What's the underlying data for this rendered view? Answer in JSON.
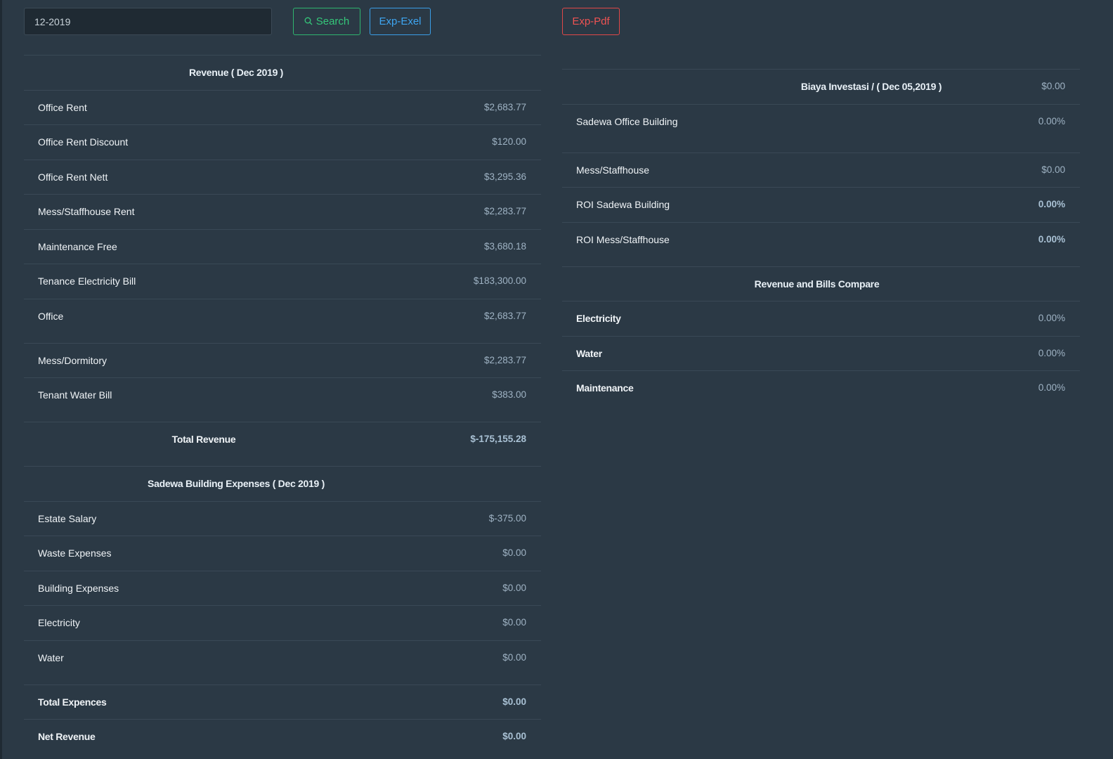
{
  "toolbar": {
    "date_value": "12-2019",
    "search_label": "Search",
    "excel_label": "Exp-Exel",
    "pdf_label": "Exp-Pdf"
  },
  "revenue": {
    "title": "Revenue ( Dec 2019 )",
    "items": [
      {
        "label": "Office Rent",
        "value": "$2,683.77"
      },
      {
        "label": "Office Rent Discount",
        "value": "$120.00"
      },
      {
        "label": "Office Rent Nett",
        "value": "$3,295.36"
      },
      {
        "label": "Mess/Staffhouse Rent",
        "value": "$2,283.77"
      },
      {
        "label": "Maintenance Free",
        "value": "$3,680.18"
      },
      {
        "label": "Tenance Electricity Bill",
        "value": "$183,300.00"
      },
      {
        "label": "Office",
        "value": "$2,683.77"
      },
      {
        "label": "Mess/Dormitory",
        "value": "$2,283.77"
      },
      {
        "label": "Tenant Water Bill",
        "value": "$383.00"
      }
    ],
    "total_label": "Total Revenue",
    "total_value": "$-175,155.28"
  },
  "expenses": {
    "title": "Sadewa Building Expenses ( Dec 2019 )",
    "items": [
      {
        "label": "Estate Salary",
        "value": "$-375.00"
      },
      {
        "label": "Waste Expenses",
        "value": "$0.00"
      },
      {
        "label": "Building Expenses",
        "value": "$0.00"
      },
      {
        "label": "Electricity",
        "value": "$0.00"
      },
      {
        "label": "Water",
        "value": "$0.00"
      }
    ],
    "total_label": "Total Expences",
    "total_value": "$0.00",
    "net_label": "Net Revenue",
    "net_value": "$0.00"
  },
  "investment": {
    "title": "Biaya Investasi / ( Dec 05,2019 )",
    "title_value": "$0.00",
    "items": [
      {
        "label": "Sadewa Office Building",
        "value": "0.00%"
      },
      {
        "label": "Mess/Staffhouse",
        "value": "$0.00"
      },
      {
        "label": "ROI Sadewa Building",
        "value": "0.00%"
      },
      {
        "label": "ROI Mess/Staffhouse",
        "value": "0.00%"
      }
    ]
  },
  "compare": {
    "title": "Revenue and Bills Compare",
    "items": [
      {
        "label": "Electricity",
        "value": "0.00%"
      },
      {
        "label": "Water",
        "value": "0.00%"
      },
      {
        "label": "Maintenance",
        "value": "0.00%"
      }
    ]
  }
}
